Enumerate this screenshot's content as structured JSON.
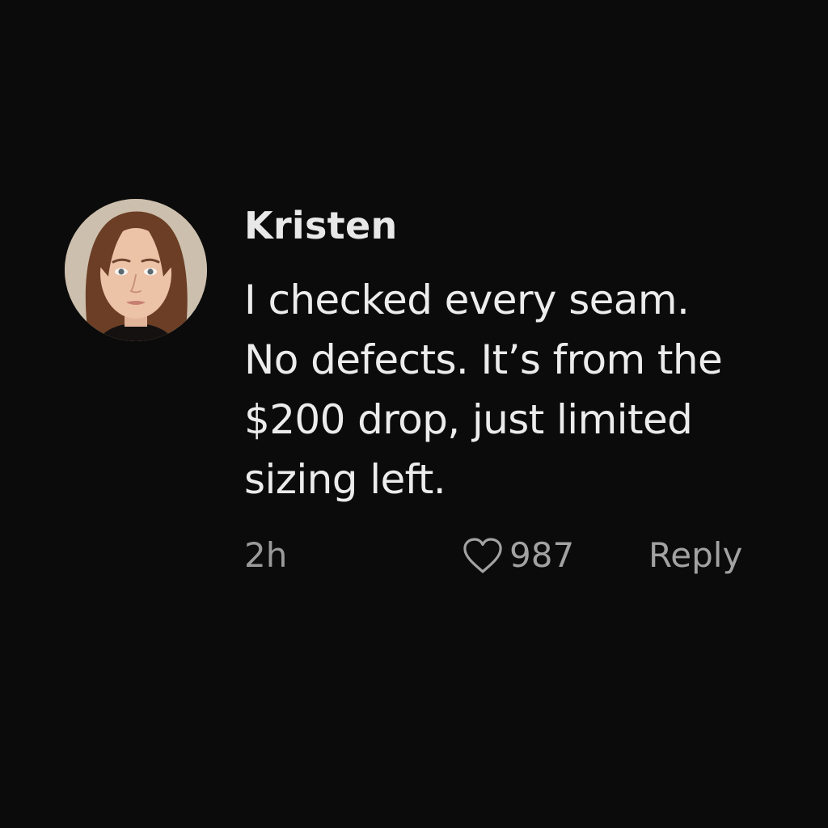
{
  "comment": {
    "author": "Kristen",
    "body_lines": [
      "I checked every seam.",
      "No defects. It’s from the",
      "$200 drop, just limited",
      "sizing left."
    ],
    "timestamp": "2h",
    "like_count": "987",
    "reply_label": "Reply",
    "like_icon": "heart-outline-icon"
  },
  "colors": {
    "background": "#0b0b0b",
    "primary_text": "#ececec",
    "secondary_text": "#9a9a9a"
  }
}
